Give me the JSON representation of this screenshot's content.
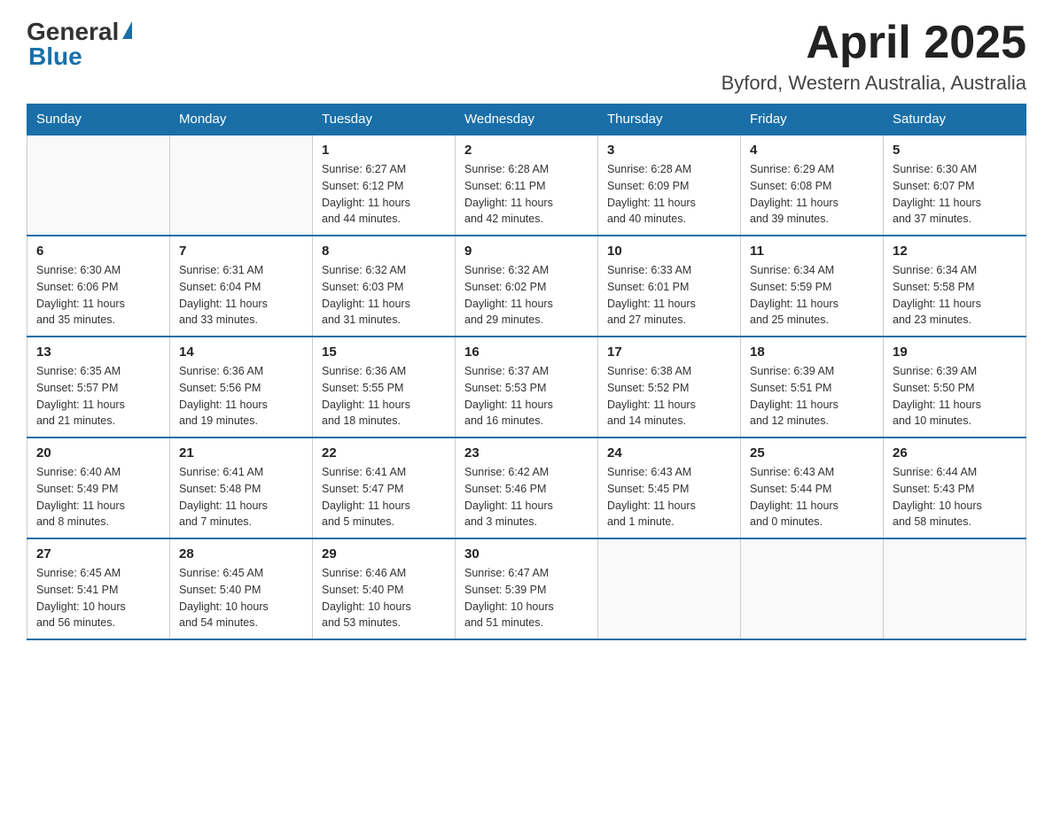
{
  "header": {
    "logo_general": "General",
    "logo_blue": "Blue",
    "month_title": "April 2025",
    "location": "Byford, Western Australia, Australia"
  },
  "days_of_week": [
    "Sunday",
    "Monday",
    "Tuesday",
    "Wednesday",
    "Thursday",
    "Friday",
    "Saturday"
  ],
  "weeks": [
    [
      {
        "day": "",
        "info": ""
      },
      {
        "day": "",
        "info": ""
      },
      {
        "day": "1",
        "info": "Sunrise: 6:27 AM\nSunset: 6:12 PM\nDaylight: 11 hours\nand 44 minutes."
      },
      {
        "day": "2",
        "info": "Sunrise: 6:28 AM\nSunset: 6:11 PM\nDaylight: 11 hours\nand 42 minutes."
      },
      {
        "day": "3",
        "info": "Sunrise: 6:28 AM\nSunset: 6:09 PM\nDaylight: 11 hours\nand 40 minutes."
      },
      {
        "day": "4",
        "info": "Sunrise: 6:29 AM\nSunset: 6:08 PM\nDaylight: 11 hours\nand 39 minutes."
      },
      {
        "day": "5",
        "info": "Sunrise: 6:30 AM\nSunset: 6:07 PM\nDaylight: 11 hours\nand 37 minutes."
      }
    ],
    [
      {
        "day": "6",
        "info": "Sunrise: 6:30 AM\nSunset: 6:06 PM\nDaylight: 11 hours\nand 35 minutes."
      },
      {
        "day": "7",
        "info": "Sunrise: 6:31 AM\nSunset: 6:04 PM\nDaylight: 11 hours\nand 33 minutes."
      },
      {
        "day": "8",
        "info": "Sunrise: 6:32 AM\nSunset: 6:03 PM\nDaylight: 11 hours\nand 31 minutes."
      },
      {
        "day": "9",
        "info": "Sunrise: 6:32 AM\nSunset: 6:02 PM\nDaylight: 11 hours\nand 29 minutes."
      },
      {
        "day": "10",
        "info": "Sunrise: 6:33 AM\nSunset: 6:01 PM\nDaylight: 11 hours\nand 27 minutes."
      },
      {
        "day": "11",
        "info": "Sunrise: 6:34 AM\nSunset: 5:59 PM\nDaylight: 11 hours\nand 25 minutes."
      },
      {
        "day": "12",
        "info": "Sunrise: 6:34 AM\nSunset: 5:58 PM\nDaylight: 11 hours\nand 23 minutes."
      }
    ],
    [
      {
        "day": "13",
        "info": "Sunrise: 6:35 AM\nSunset: 5:57 PM\nDaylight: 11 hours\nand 21 minutes."
      },
      {
        "day": "14",
        "info": "Sunrise: 6:36 AM\nSunset: 5:56 PM\nDaylight: 11 hours\nand 19 minutes."
      },
      {
        "day": "15",
        "info": "Sunrise: 6:36 AM\nSunset: 5:55 PM\nDaylight: 11 hours\nand 18 minutes."
      },
      {
        "day": "16",
        "info": "Sunrise: 6:37 AM\nSunset: 5:53 PM\nDaylight: 11 hours\nand 16 minutes."
      },
      {
        "day": "17",
        "info": "Sunrise: 6:38 AM\nSunset: 5:52 PM\nDaylight: 11 hours\nand 14 minutes."
      },
      {
        "day": "18",
        "info": "Sunrise: 6:39 AM\nSunset: 5:51 PM\nDaylight: 11 hours\nand 12 minutes."
      },
      {
        "day": "19",
        "info": "Sunrise: 6:39 AM\nSunset: 5:50 PM\nDaylight: 11 hours\nand 10 minutes."
      }
    ],
    [
      {
        "day": "20",
        "info": "Sunrise: 6:40 AM\nSunset: 5:49 PM\nDaylight: 11 hours\nand 8 minutes."
      },
      {
        "day": "21",
        "info": "Sunrise: 6:41 AM\nSunset: 5:48 PM\nDaylight: 11 hours\nand 7 minutes."
      },
      {
        "day": "22",
        "info": "Sunrise: 6:41 AM\nSunset: 5:47 PM\nDaylight: 11 hours\nand 5 minutes."
      },
      {
        "day": "23",
        "info": "Sunrise: 6:42 AM\nSunset: 5:46 PM\nDaylight: 11 hours\nand 3 minutes."
      },
      {
        "day": "24",
        "info": "Sunrise: 6:43 AM\nSunset: 5:45 PM\nDaylight: 11 hours\nand 1 minute."
      },
      {
        "day": "25",
        "info": "Sunrise: 6:43 AM\nSunset: 5:44 PM\nDaylight: 11 hours\nand 0 minutes."
      },
      {
        "day": "26",
        "info": "Sunrise: 6:44 AM\nSunset: 5:43 PM\nDaylight: 10 hours\nand 58 minutes."
      }
    ],
    [
      {
        "day": "27",
        "info": "Sunrise: 6:45 AM\nSunset: 5:41 PM\nDaylight: 10 hours\nand 56 minutes."
      },
      {
        "day": "28",
        "info": "Sunrise: 6:45 AM\nSunset: 5:40 PM\nDaylight: 10 hours\nand 54 minutes."
      },
      {
        "day": "29",
        "info": "Sunrise: 6:46 AM\nSunset: 5:40 PM\nDaylight: 10 hours\nand 53 minutes."
      },
      {
        "day": "30",
        "info": "Sunrise: 6:47 AM\nSunset: 5:39 PM\nDaylight: 10 hours\nand 51 minutes."
      },
      {
        "day": "",
        "info": ""
      },
      {
        "day": "",
        "info": ""
      },
      {
        "day": "",
        "info": ""
      }
    ]
  ]
}
